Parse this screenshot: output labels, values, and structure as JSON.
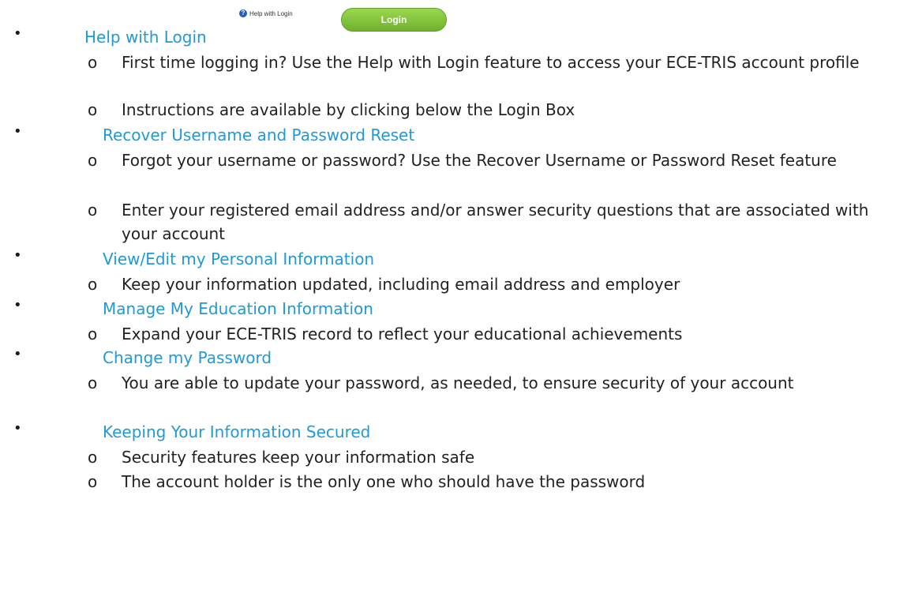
{
  "top_preview": {
    "help_text": "Help with Login",
    "login_button": "Login"
  },
  "sections": [
    {
      "title": "Help with Login",
      "items": [
        "First time logging in? Use the Help with Login feature to access your ECE-TRIS account profile",
        "Instructions are available by clicking below the Login Box"
      ]
    },
    {
      "title": "Recover Username and Password Reset",
      "items": [
        "Forgot your username or password?  Use the Recover Username or Password Reset feature",
        "Enter your registered email address and/or answer security questions that are associated with your account"
      ]
    },
    {
      "title": "View/Edit my Personal Information",
      "items": [
        "Keep your information updated, including email address and employer"
      ]
    },
    {
      "title": "Manage My Education Information",
      "items": [
        "Expand your ECE-TRIS record to reflect your educational achievements"
      ]
    },
    {
      "title": "Change my Password",
      "items": [
        "You are able to update your password, as needed, to ensure security of your account"
      ]
    },
    {
      "title": "Keeping Your Information Secured",
      "items": [
        "Security features keep your information safe",
        "The account holder is the only one who should have the password"
      ]
    }
  ]
}
